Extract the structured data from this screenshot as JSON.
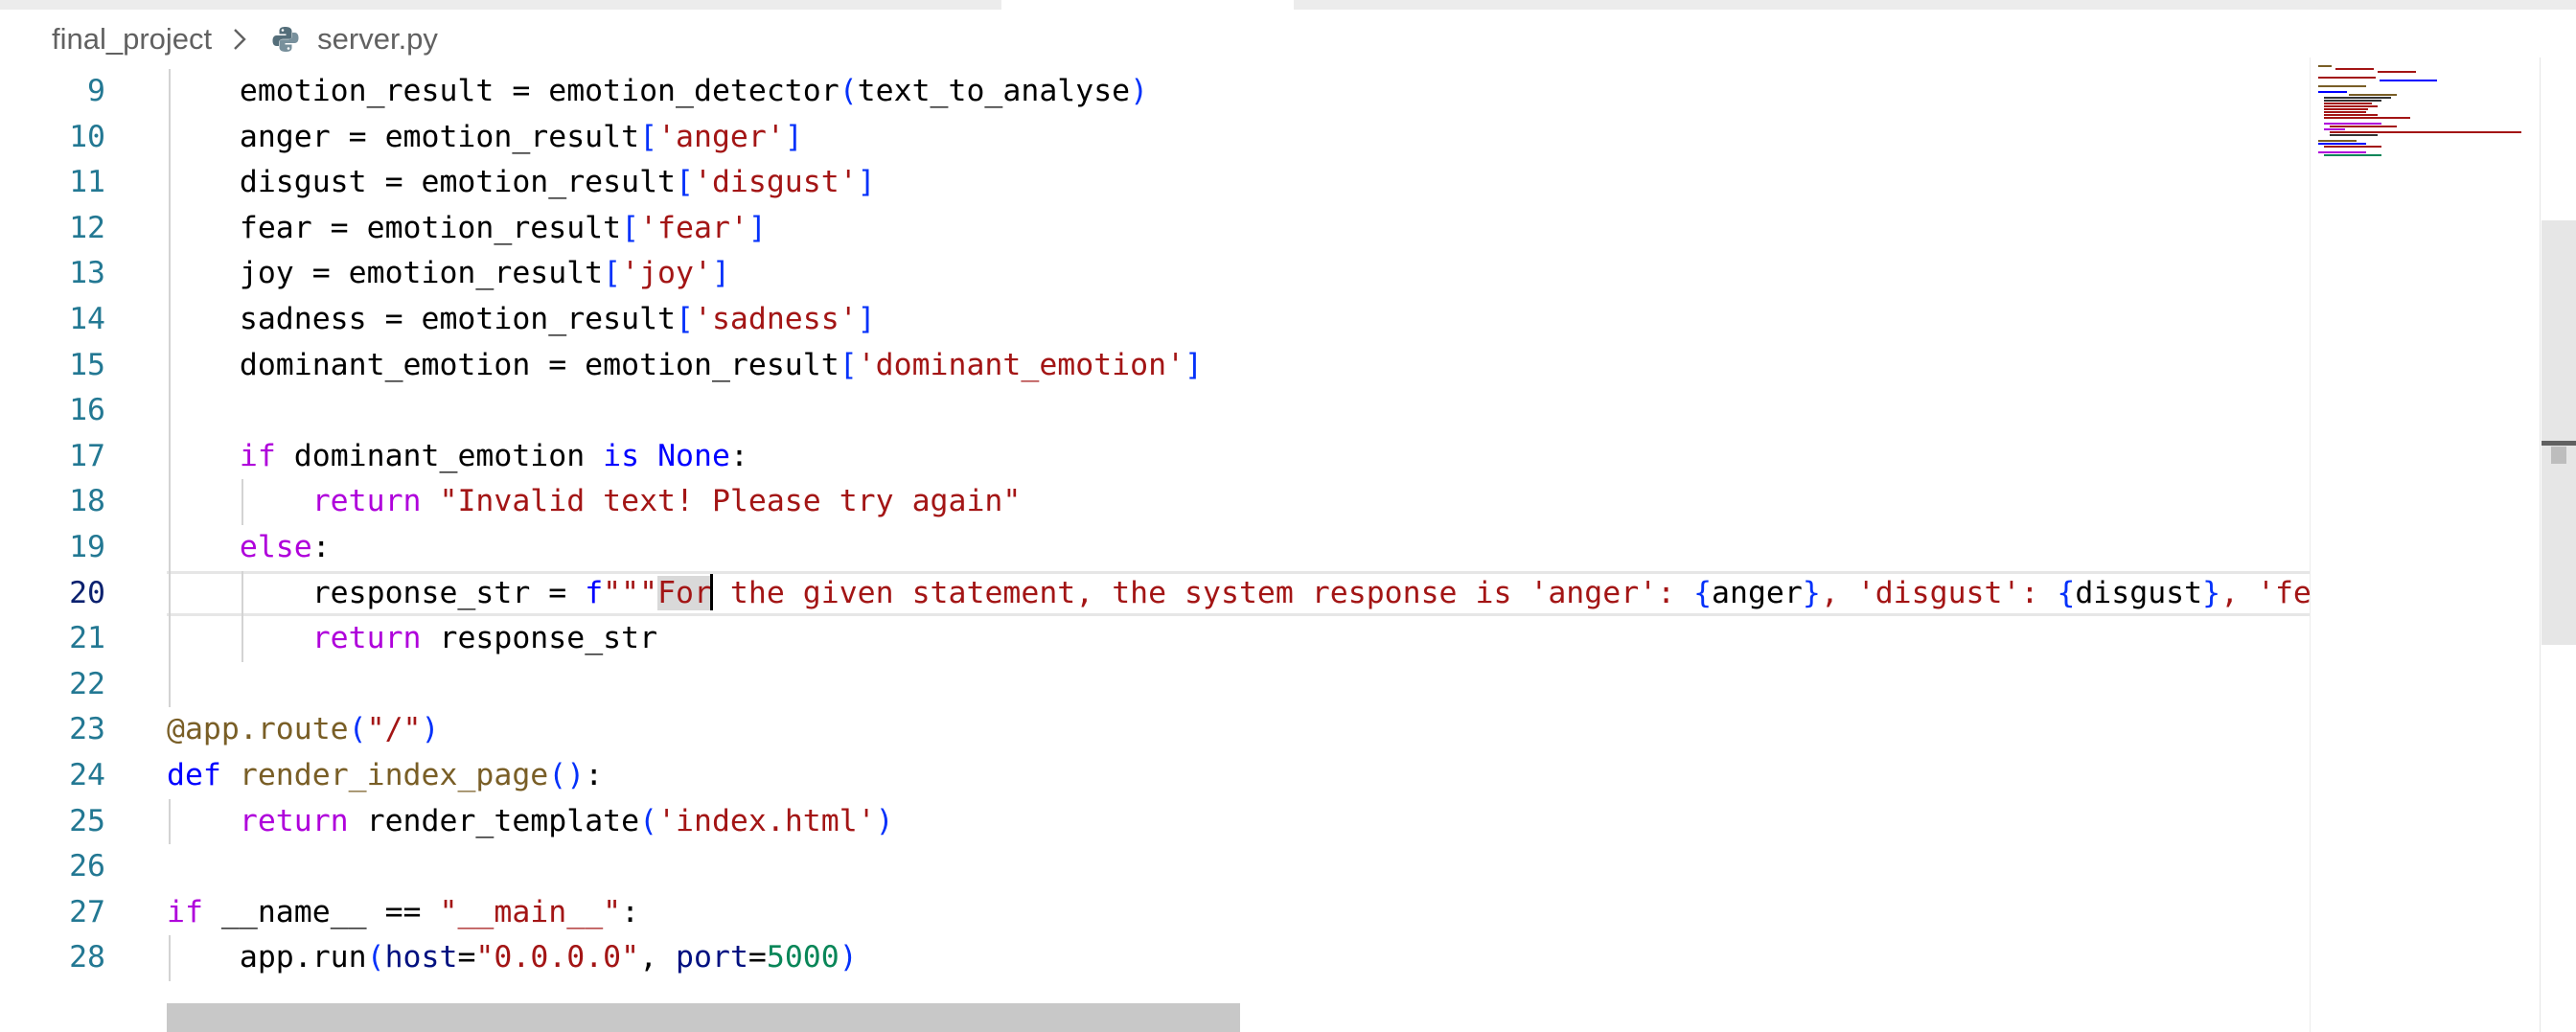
{
  "breadcrumb": {
    "folder": "final_project",
    "file": "server.py"
  },
  "icons": {
    "separator": "chevron-right-icon",
    "file_type": "python-file-icon"
  },
  "colors": {
    "keyword": "#0000ff",
    "control": "#af00db",
    "function": "#795e26",
    "string": "#a31515",
    "number": "#098658",
    "line_number": "#237893",
    "line_number_active": "#0b216f"
  },
  "editor": {
    "active_line": 20,
    "lines": [
      {
        "n": "9",
        "tokens": [
          [
            "",
            "    emotion_result = emotion_detector"
          ],
          [
            "t-b1",
            "("
          ],
          [
            "",
            "text_to_analyse"
          ],
          [
            "t-b1",
            ")"
          ]
        ]
      },
      {
        "n": "10",
        "tokens": [
          [
            "",
            "    anger = emotion_result"
          ],
          [
            "t-b1",
            "["
          ],
          [
            "t-str",
            "'anger'"
          ],
          [
            "t-b1",
            "]"
          ]
        ]
      },
      {
        "n": "11",
        "tokens": [
          [
            "",
            "    disgust = emotion_result"
          ],
          [
            "t-b1",
            "["
          ],
          [
            "t-str",
            "'disgust'"
          ],
          [
            "t-b1",
            "]"
          ]
        ]
      },
      {
        "n": "12",
        "tokens": [
          [
            "",
            "    fear = emotion_result"
          ],
          [
            "t-b1",
            "["
          ],
          [
            "t-str",
            "'fear'"
          ],
          [
            "t-b1",
            "]"
          ]
        ]
      },
      {
        "n": "13",
        "tokens": [
          [
            "",
            "    joy = emotion_result"
          ],
          [
            "t-b1",
            "["
          ],
          [
            "t-str",
            "'joy'"
          ],
          [
            "t-b1",
            "]"
          ]
        ]
      },
      {
        "n": "14",
        "tokens": [
          [
            "",
            "    sadness = emotion_result"
          ],
          [
            "t-b1",
            "["
          ],
          [
            "t-str",
            "'sadness'"
          ],
          [
            "t-b1",
            "]"
          ]
        ]
      },
      {
        "n": "15",
        "tokens": [
          [
            "",
            "    dominant_emotion = emotion_result"
          ],
          [
            "t-b1",
            "["
          ],
          [
            "t-str",
            "'dominant_emotion'"
          ],
          [
            "t-b1",
            "]"
          ]
        ]
      },
      {
        "n": "16",
        "tokens": []
      },
      {
        "n": "17",
        "tokens": [
          [
            "",
            "    "
          ],
          [
            "t-ctl",
            "if"
          ],
          [
            "",
            " dominant_emotion "
          ],
          [
            "t-kw",
            "is"
          ],
          [
            "",
            " "
          ],
          [
            "t-kw",
            "None"
          ],
          [
            "",
            ":"
          ]
        ]
      },
      {
        "n": "18",
        "tokens": [
          [
            "",
            "        "
          ],
          [
            "t-ctl",
            "return"
          ],
          [
            "",
            " "
          ],
          [
            "t-str",
            "\"Invalid text! Please try again\""
          ]
        ]
      },
      {
        "n": "19",
        "tokens": [
          [
            "",
            "    "
          ],
          [
            "t-ctl",
            "else"
          ],
          [
            "",
            ":"
          ]
        ]
      },
      {
        "n": "20",
        "tokens": [
          [
            "",
            "        response_str = "
          ],
          [
            "t-kw",
            "f"
          ],
          [
            "t-str",
            "\"\"\""
          ],
          [
            "t-str sel",
            "For"
          ],
          [
            "cursor",
            ""
          ],
          [
            "t-str",
            " the given statement, the system response is 'anger': "
          ],
          [
            "t-b1",
            "{"
          ],
          [
            "",
            "anger"
          ],
          [
            "t-b1",
            "}"
          ],
          [
            "t-str",
            ", 'disgust': "
          ],
          [
            "t-b1",
            "{"
          ],
          [
            "",
            "disgust"
          ],
          [
            "t-b1",
            "}"
          ],
          [
            "t-str",
            ", 'fear': "
          ]
        ]
      },
      {
        "n": "21",
        "tokens": [
          [
            "",
            "        "
          ],
          [
            "t-ctl",
            "return"
          ],
          [
            "",
            " response_str"
          ]
        ]
      },
      {
        "n": "22",
        "tokens": []
      },
      {
        "n": "23",
        "tokens": [
          [
            "t-fn",
            "@app.route"
          ],
          [
            "t-b1",
            "("
          ],
          [
            "t-str",
            "\"/\""
          ],
          [
            "t-b1",
            ")"
          ]
        ]
      },
      {
        "n": "24",
        "tokens": [
          [
            "t-kw",
            "def"
          ],
          [
            "",
            " "
          ],
          [
            "t-fn",
            "render_index_page"
          ],
          [
            "t-b1",
            "()"
          ],
          [
            "",
            ":"
          ]
        ]
      },
      {
        "n": "25",
        "tokens": [
          [
            "",
            "    "
          ],
          [
            "t-ctl",
            "return"
          ],
          [
            "",
            " render_template"
          ],
          [
            "t-b1",
            "("
          ],
          [
            "t-str",
            "'index.html'"
          ],
          [
            "t-b1",
            ")"
          ]
        ]
      },
      {
        "n": "26",
        "tokens": []
      },
      {
        "n": "27",
        "tokens": [
          [
            "t-ctl",
            "if"
          ],
          [
            "",
            " __name__ == "
          ],
          [
            "t-str",
            "\"__main__\""
          ],
          [
            "",
            ":"
          ]
        ]
      },
      {
        "n": "28",
        "tokens": [
          [
            "",
            "    app.run"
          ],
          [
            "t-b1",
            "("
          ],
          [
            "t-param",
            "host"
          ],
          [
            "",
            "="
          ],
          [
            "t-str",
            "\"0.0.0.0\""
          ],
          [
            "",
            ", "
          ],
          [
            "t-param",
            "port"
          ],
          [
            "",
            "="
          ],
          [
            "t-num",
            "5000"
          ],
          [
            "t-b1",
            ")"
          ]
        ]
      }
    ]
  }
}
